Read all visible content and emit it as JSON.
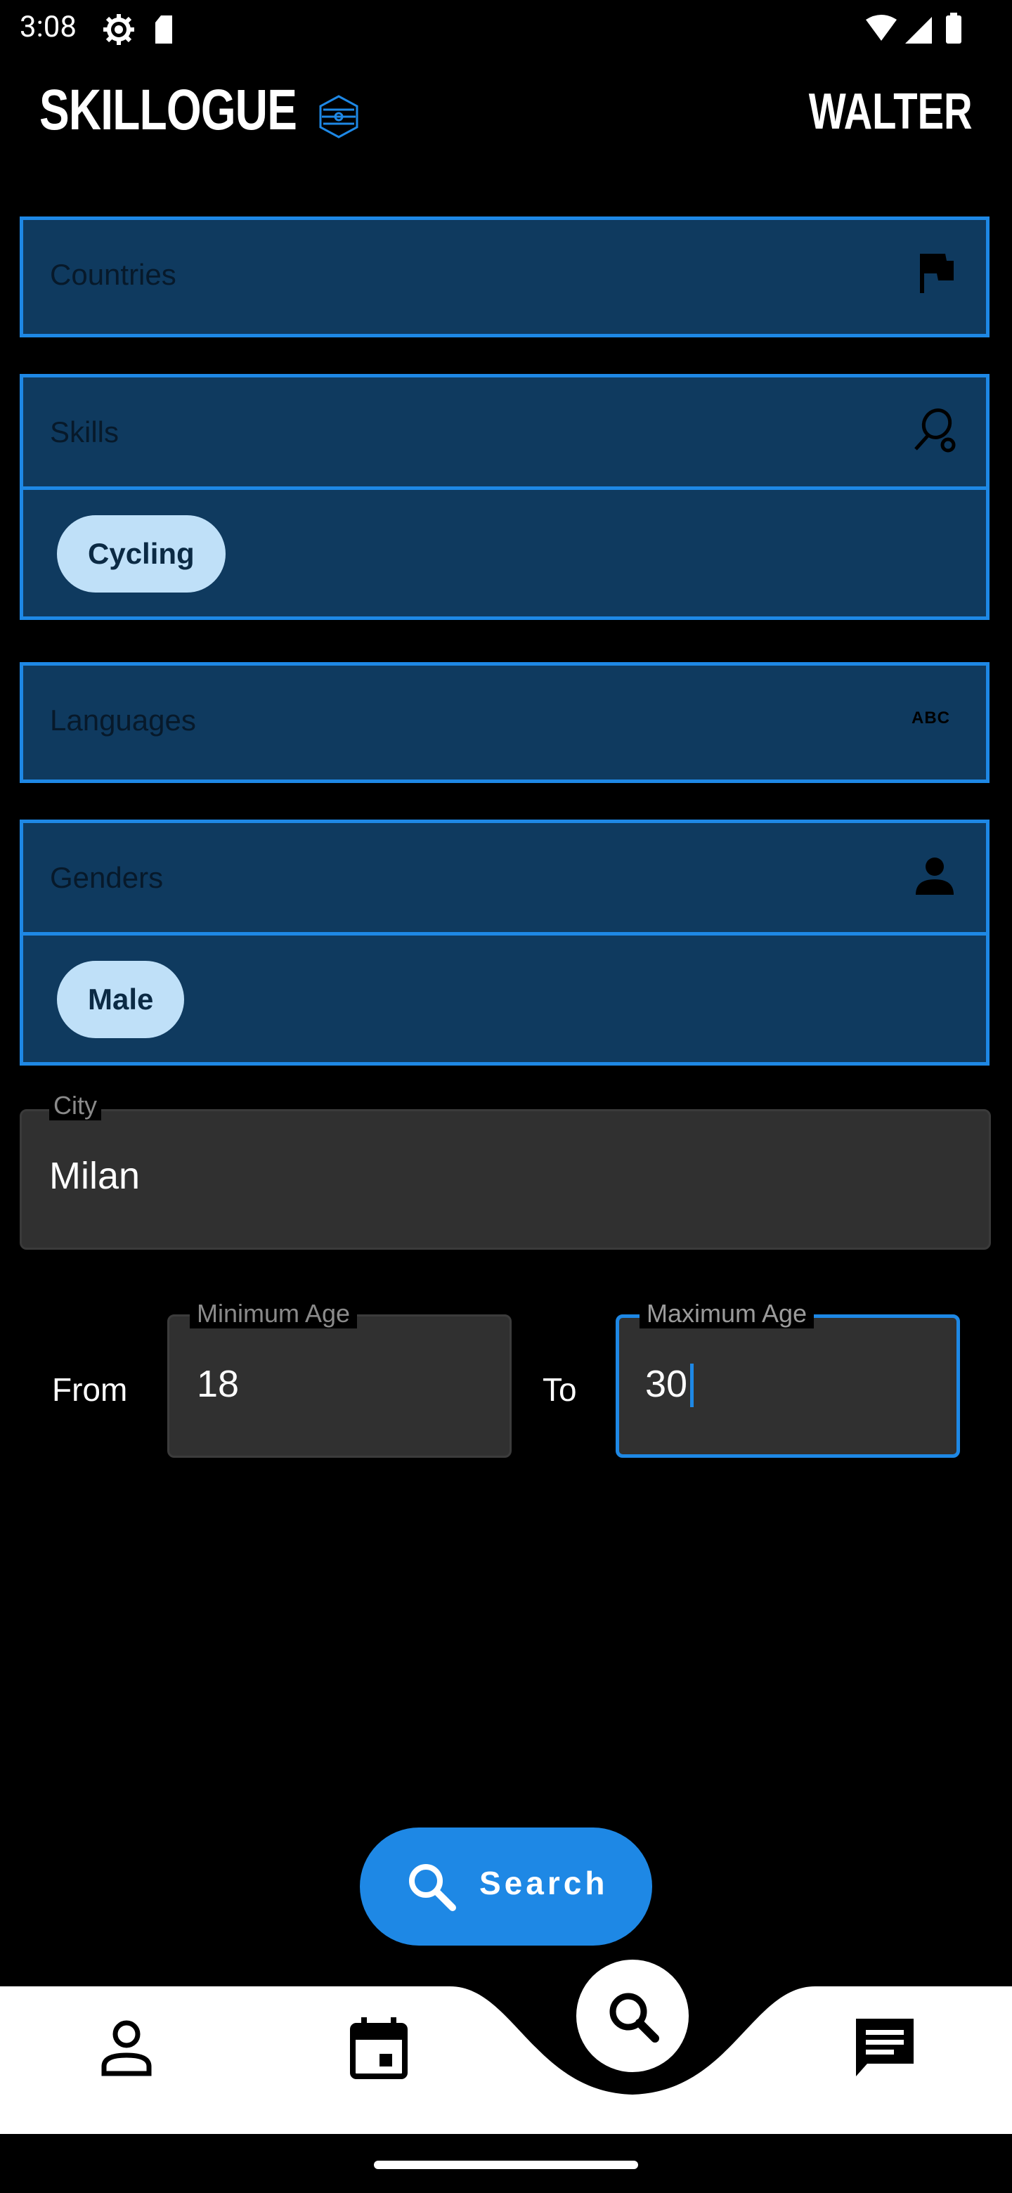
{
  "status_bar": {
    "time": "3:08"
  },
  "header": {
    "brand": "SKILLOGUE",
    "user_name": "WALTER"
  },
  "filters": {
    "countries": {
      "label": "Countries"
    },
    "skills": {
      "label": "Skills",
      "chips": [
        "Cycling"
      ]
    },
    "languages": {
      "label": "Languages"
    },
    "genders": {
      "label": "Genders",
      "chips": [
        "Male"
      ]
    }
  },
  "city": {
    "label": "City",
    "value": "Milan"
  },
  "age": {
    "from_label": "From",
    "to_label": "To",
    "min_label": "Minimum Age",
    "min_value": "18",
    "max_label": "Maximum Age",
    "max_value": "30"
  },
  "search_button": {
    "label": "Search"
  },
  "colors": {
    "accent": "#1e88e5",
    "filter_bg": "#0f3a5f",
    "chip_bg": "#bfe0f8",
    "field_bg": "#303030"
  },
  "nav": {
    "items": [
      "profile-icon",
      "calendar-icon",
      "search-icon",
      "chat-icon"
    ],
    "active": "search-icon"
  }
}
